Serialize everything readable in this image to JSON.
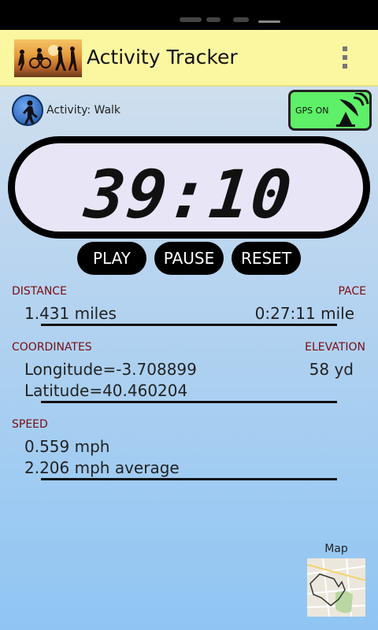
{
  "app": {
    "title": "Activity Tracker"
  },
  "activity": {
    "label": "Activity: Walk",
    "icon": "walker-icon"
  },
  "gps": {
    "label": "GPS ON",
    "icon": "satellite-dish-icon",
    "color": "#5ef068"
  },
  "timer": {
    "value": "39:10"
  },
  "controls": {
    "play": "PLAY",
    "pause": "PAUSE",
    "reset": "RESET"
  },
  "stats": {
    "distance": {
      "label": "DISTANCE",
      "value": "1.431 miles"
    },
    "pace": {
      "label": "PACE",
      "value": "0:27:11 mile"
    },
    "coordinates": {
      "label": "COORDINATES",
      "longitude": "Longitude=-3.708899",
      "latitude": "Latitude=40.460204"
    },
    "elevation": {
      "label": "ELEVATION",
      "value": "58 yd"
    },
    "speed": {
      "label": "SPEED",
      "current": "0.559 mph",
      "average": "2.206 mph average"
    }
  },
  "map": {
    "label": "Map",
    "icon": "map-thumbnail"
  },
  "colors": {
    "actionbar": "#fbf6a0",
    "label_red": "#7a0c14",
    "gps_green": "#5ef068"
  }
}
